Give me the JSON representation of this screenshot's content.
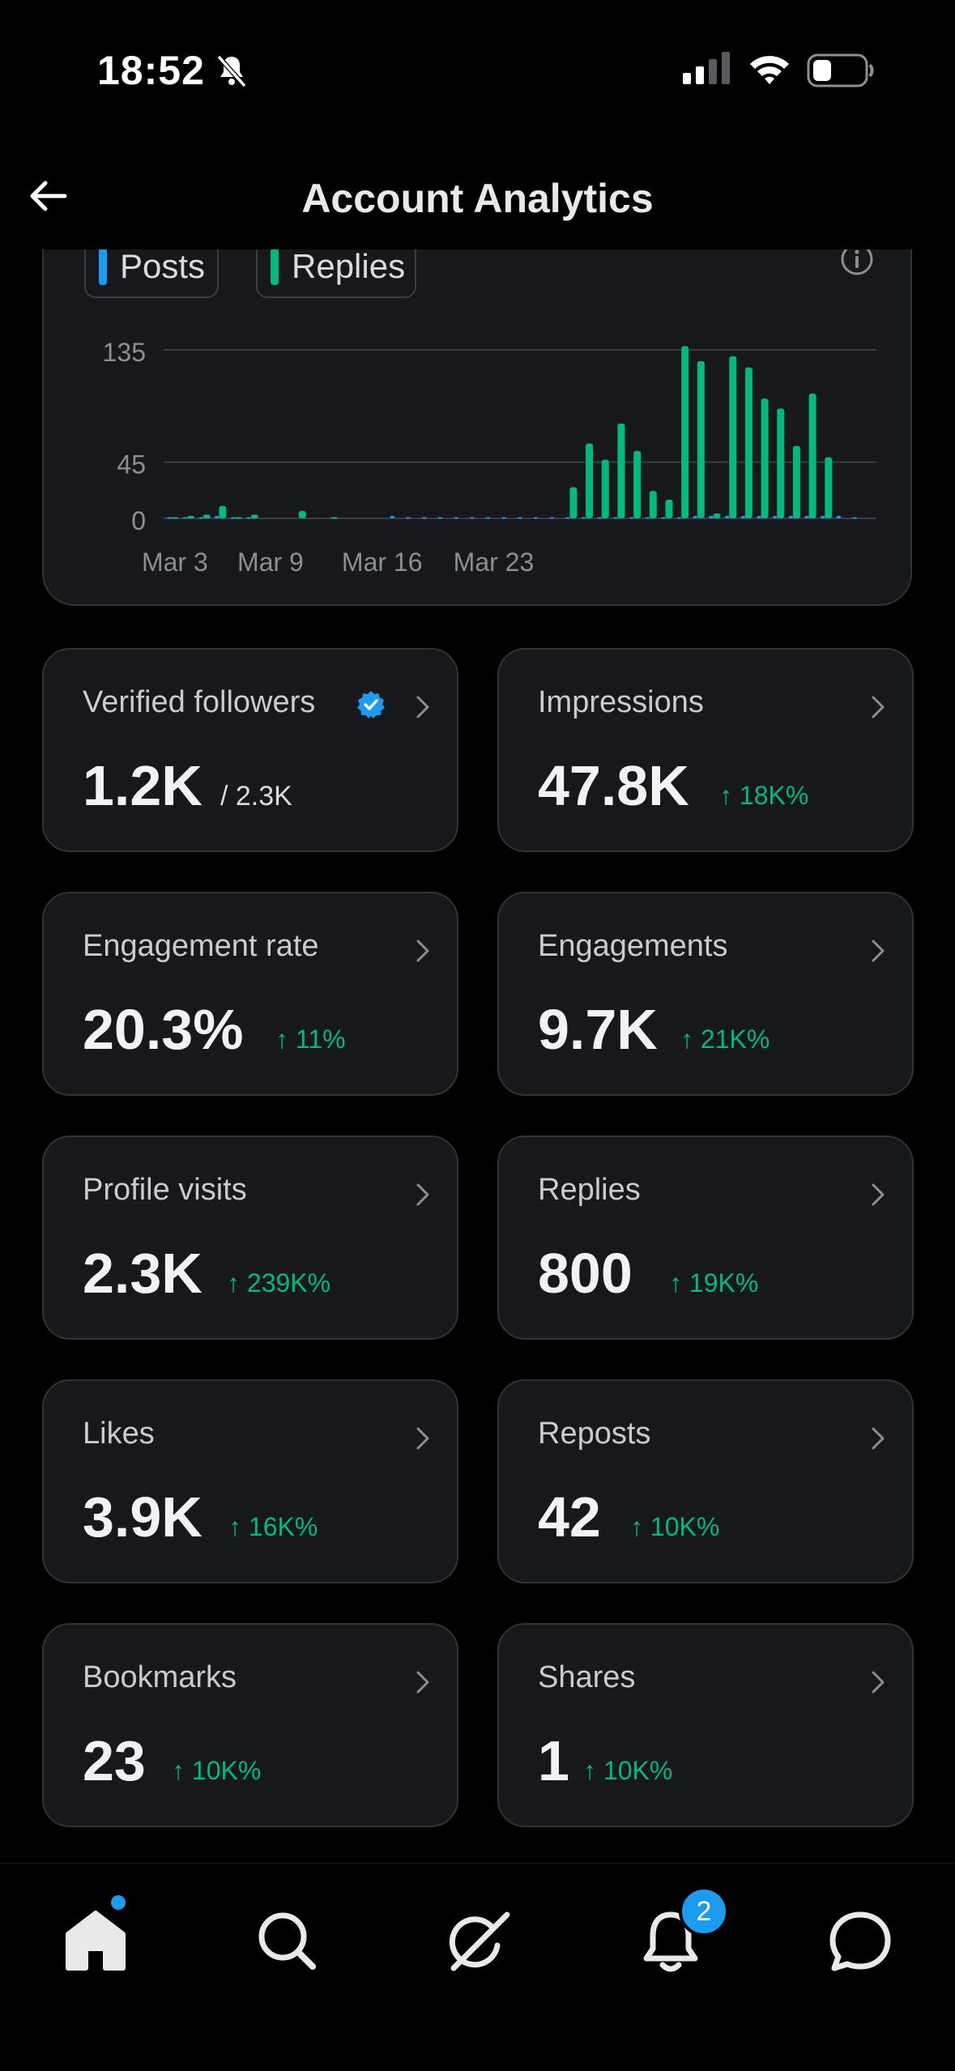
{
  "status_bar": {
    "time": "18:52"
  },
  "header": {
    "title": "Account Analytics"
  },
  "chart": {
    "legend": [
      {
        "label": "Posts",
        "color": "#1d9bf0"
      },
      {
        "label": "Replies",
        "color": "#00ba7c"
      }
    ]
  },
  "chart_data": {
    "type": "bar",
    "y_ticks": [
      0,
      45,
      135
    ],
    "ylim": [
      0,
      135
    ],
    "x_tick_labels": [
      "Mar 3",
      "Mar 9",
      "Mar 16",
      "Mar 23"
    ],
    "series": [
      {
        "name": "Posts",
        "color": "#1d9bf0",
        "values": [
          1,
          1,
          1,
          2,
          1,
          1,
          0,
          0,
          0,
          0,
          0,
          0,
          0,
          0,
          2,
          1,
          1,
          1,
          1,
          1,
          1,
          1,
          1,
          1,
          1,
          1,
          1,
          1,
          1,
          1,
          1,
          1,
          1,
          2,
          2,
          2,
          2,
          2,
          2,
          2,
          2,
          2,
          2,
          1
        ]
      },
      {
        "name": "Replies",
        "color": "#00ba7c",
        "values": [
          1,
          2,
          3,
          10,
          1,
          3,
          0,
          0,
          6,
          0,
          1,
          0,
          0,
          0,
          0,
          0,
          0,
          0,
          0,
          0,
          0,
          0,
          0,
          0,
          0,
          25,
          60,
          47,
          76,
          54,
          22,
          15,
          138,
          126,
          4,
          130,
          121,
          96,
          88,
          58,
          100,
          49,
          0,
          0
        ]
      }
    ]
  },
  "metrics": [
    {
      "label": "Verified followers",
      "value": "1.2K",
      "sub": "/ 2.3K",
      "verified": true
    },
    {
      "label": "Impressions",
      "value": "47.8K",
      "change": "↑ 18K%"
    },
    {
      "label": "Engagement rate",
      "value": "20.3%",
      "change": "↑ 11%"
    },
    {
      "label": "Engagements",
      "value": "9.7K",
      "change": "↑ 21K%"
    },
    {
      "label": "Profile visits",
      "value": "2.3K",
      "change": "↑ 239K%"
    },
    {
      "label": "Replies",
      "value": "800",
      "change": "↑ 19K%"
    },
    {
      "label": "Likes",
      "value": "3.9K",
      "change": "↑ 16K%"
    },
    {
      "label": "Reposts",
      "value": "42",
      "change": "↑ 10K%"
    },
    {
      "label": "Bookmarks",
      "value": "23",
      "change": "↑ 10K%"
    },
    {
      "label": "Shares",
      "value": "1",
      "change": "↑ 10K%"
    }
  ],
  "nav": {
    "items": [
      "home-icon",
      "search-icon",
      "grok-icon",
      "bell-icon",
      "messages-icon"
    ],
    "notification_count": "2"
  },
  "colors": {
    "accent": "#1d9bf0",
    "positive": "#00ba7c",
    "card": "#16181c",
    "border": "#2f3336"
  }
}
